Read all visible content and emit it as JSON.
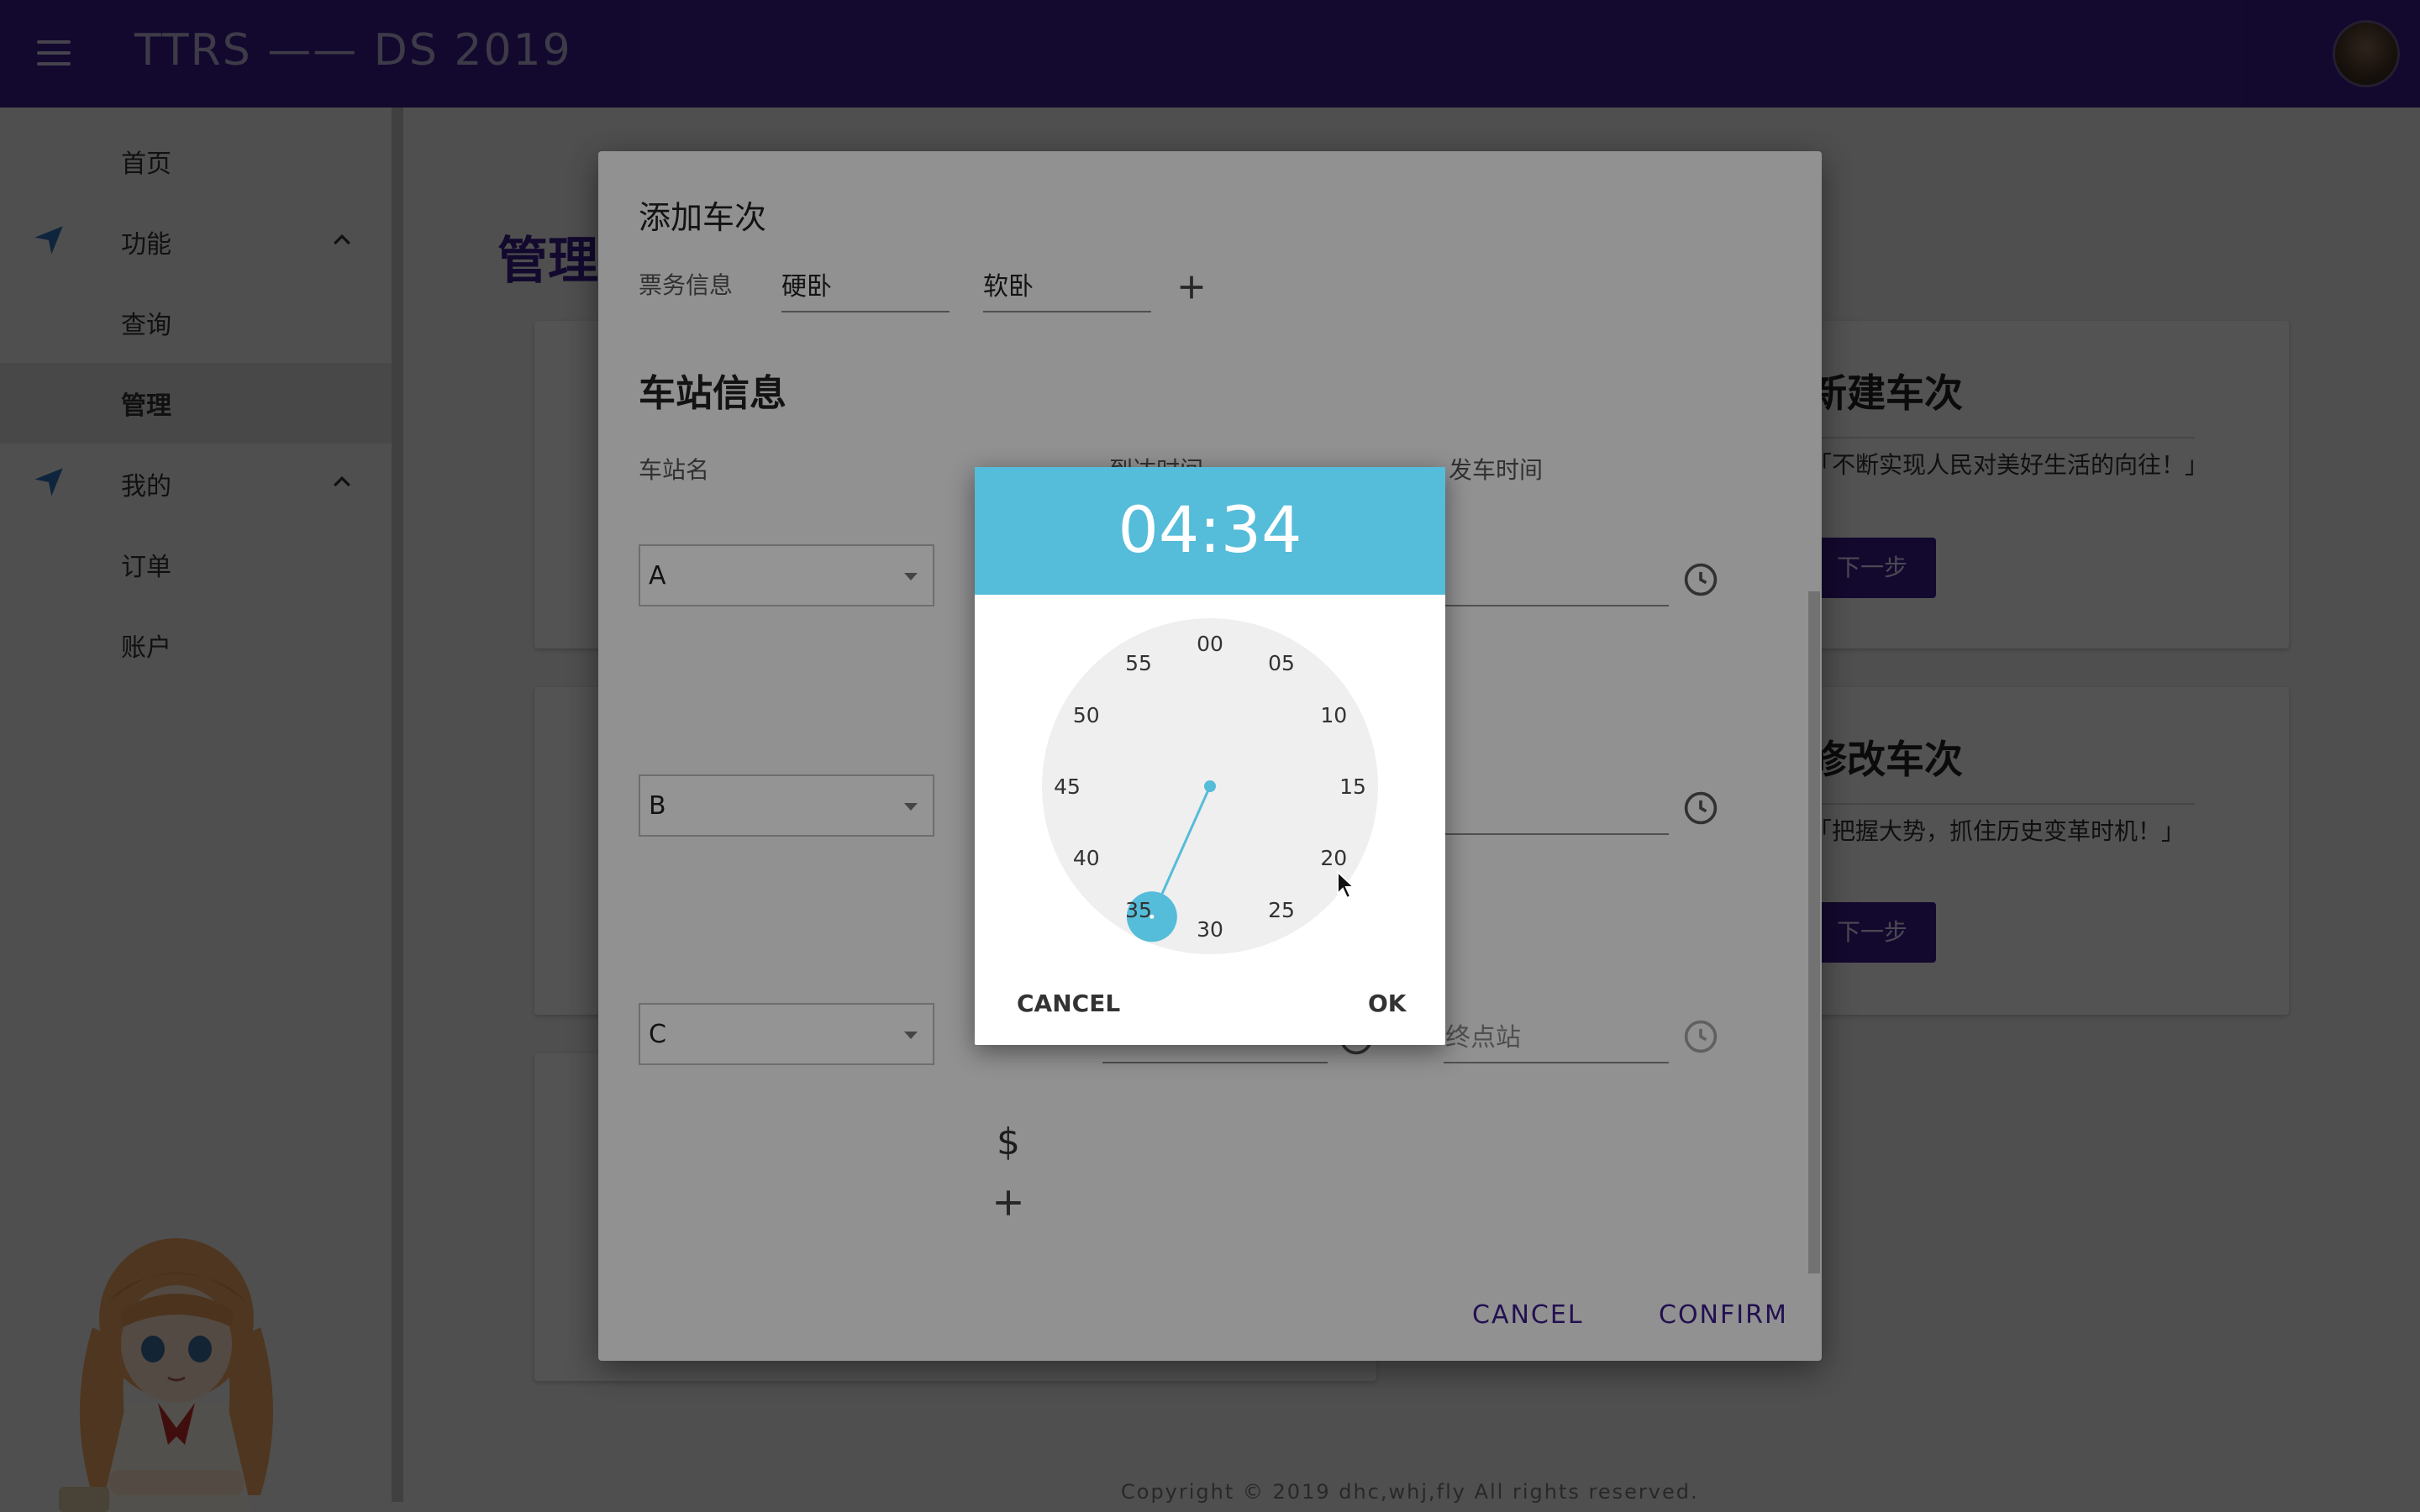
{
  "app": {
    "title": "TTRS —— DS 2019"
  },
  "sidebar": {
    "items": [
      {
        "label": "首页"
      },
      {
        "label": "功能"
      },
      {
        "label": "查询"
      },
      {
        "label": "管理"
      },
      {
        "label": "我的"
      },
      {
        "label": "订单"
      },
      {
        "label": "账户"
      }
    ]
  },
  "main": {
    "title": "管理",
    "cards": [
      {
        "title": "新建车次",
        "subtitle": "「不断实现人民对美好生活的向往！」",
        "button": "下一步"
      },
      {
        "title": "修改车次",
        "subtitle": "「把握大势，抓住历史变革时机！」",
        "button": "下一步"
      }
    ],
    "copyright": "Copyright © 2019 dhc,whj,fly All rights reserved."
  },
  "dialog": {
    "title": "添加车次",
    "ticket_label": "票务信息",
    "ticket_types": [
      "硬卧",
      "软卧"
    ],
    "section_title": "车站信息",
    "col_station": "车站名",
    "col_arrive": "到达时间",
    "col_depart": "发车时间",
    "stations": [
      "A",
      "B",
      "C"
    ],
    "last_depart_placeholder": "终点站",
    "price_icon": "$",
    "cancel": "CANCEL",
    "confirm": "CONFIRM"
  },
  "time_picker": {
    "time": "04:34",
    "selected_minute": 34,
    "minute_labels": [
      "00",
      "05",
      "10",
      "15",
      "20",
      "25",
      "30",
      "35",
      "40",
      "45",
      "50",
      "55"
    ],
    "cancel": "CANCEL",
    "ok": "OK",
    "accent": "#55bcd9"
  },
  "colors": {
    "primary": "#3b1c8a",
    "accent": "#55bcd9"
  }
}
